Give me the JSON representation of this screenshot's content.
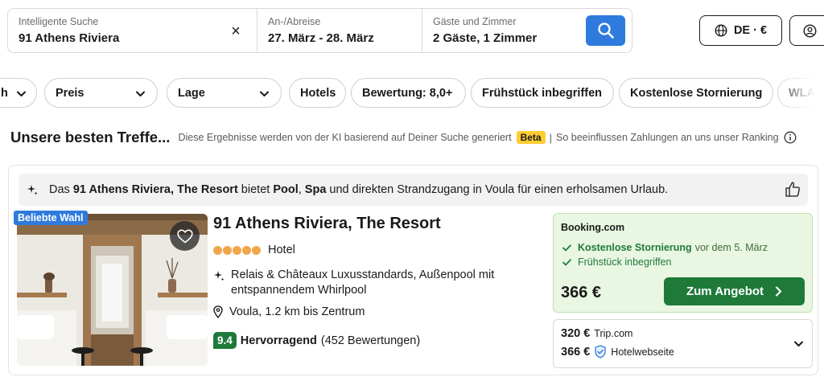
{
  "search": {
    "destination_label": "Intelligente Suche",
    "destination_value": "91 Athens Riviera",
    "clear_glyph": "×",
    "dates_label": "An-/Abreise",
    "dates_value": "27. März - 28. März",
    "guests_label": "Gäste und Zimmer",
    "guests_value": "2 Gäste, 1 Zimmer",
    "search_icon": "search-icon"
  },
  "header": {
    "language_currency": "DE · €",
    "globe_icon": "globe-icon",
    "account_icon": "user-icon"
  },
  "filters": {
    "chips": [
      {
        "label": "h",
        "has_dropdown": true
      },
      {
        "label": "Preis",
        "has_dropdown": true
      },
      {
        "label": "Lage",
        "has_dropdown": true
      },
      {
        "label": "Hotels",
        "has_dropdown": false
      },
      {
        "label": "Bewertung: 8,0+",
        "has_dropdown": false
      },
      {
        "label": "Frühstück inbegriffen",
        "has_dropdown": false
      },
      {
        "label": "Kostenlose Stornierung",
        "has_dropdown": false
      },
      {
        "label": "WLAN",
        "has_dropdown": false
      }
    ]
  },
  "results": {
    "title": "Unsere besten Treffe...",
    "description": "Diese Ergebnisse werden von der KI basierend auf Deiner Suche generiert",
    "beta_badge": "Beta",
    "separator": "|",
    "ranking_link": "So beeinflussen Zahlungen an uns unser Ranking"
  },
  "hotel": {
    "ai_summary": {
      "p1": "Das ",
      "name": "91 Athens Riviera, The Resort",
      "p2": " bietet ",
      "pool": "Pool",
      "p3": ", ",
      "spa": "Spa",
      "p4": " und direkten Strandzugang in Voula für einen erholsamen Urlaub."
    },
    "badge": "Beliebte Wahl",
    "name": "91 Athens Riviera, The Resort",
    "stars": 5,
    "type": "Hotel",
    "feature": "Relais & Châteaux Luxusstandards, Außenpool mit entspannendem Whirlpool",
    "location": "Voula, 1.2 km bis Zentrum",
    "score": "9.4",
    "rating_word": "Hervorragend",
    "review_count": "(452 Bewertungen)"
  },
  "offer": {
    "provider": "Booking.com",
    "perk1_strong": "Kostenlose Stornierung",
    "perk1_note": "vor dem 5. März",
    "perk2": "Frühstück inbegriffen",
    "price": "366 €",
    "cta_label": "Zum Angebot",
    "accent_color": "#1f7a3a"
  },
  "alternatives": [
    {
      "price": "320 €",
      "provider": "Trip.com",
      "verified": false
    },
    {
      "price": "366 €",
      "provider": "Hotelwebseite",
      "verified": true
    }
  ],
  "colors": {
    "primary_blue": "#2f7bdd",
    "green": "#1f7a3a",
    "offer_bg": "#e9f6e2",
    "beta_yellow": "#ffcc33",
    "star_orange": "#f0a64a"
  }
}
